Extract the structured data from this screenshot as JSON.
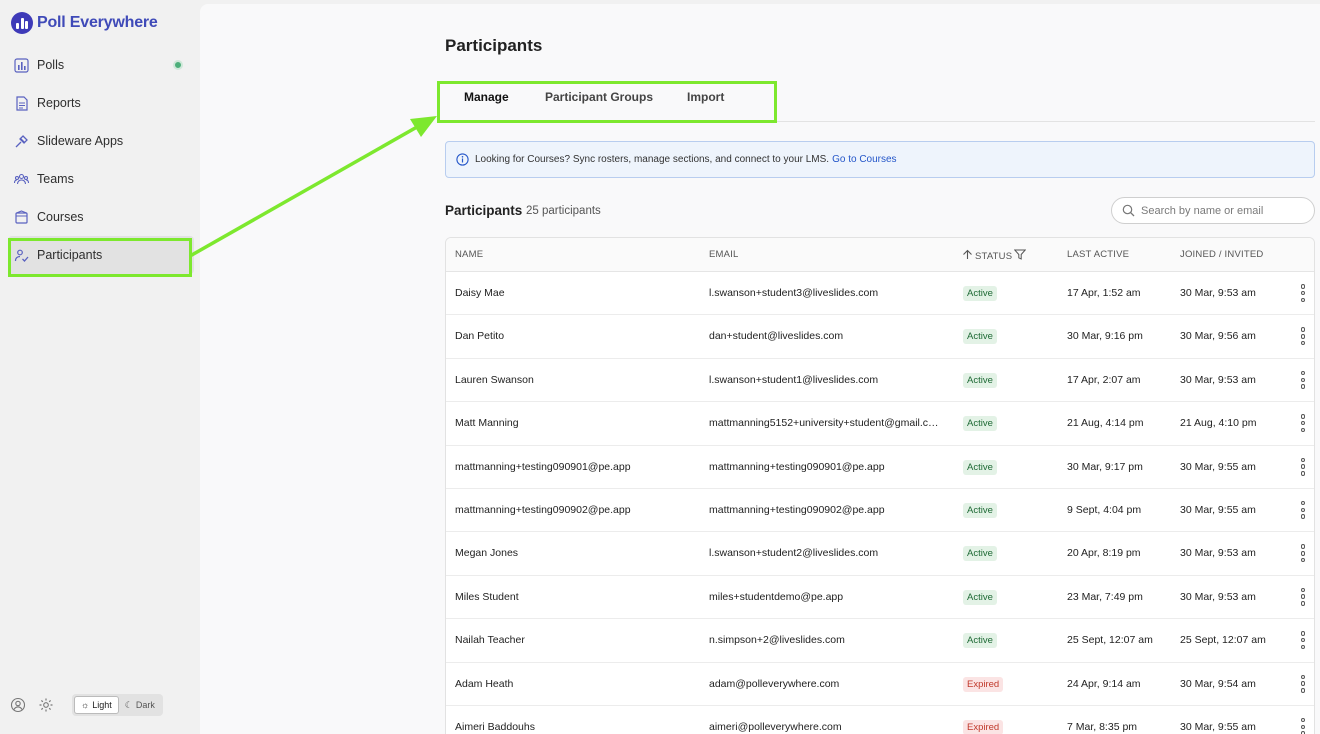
{
  "app": {
    "name": "Poll Everywhere"
  },
  "sidebar": {
    "items": [
      {
        "label": "Polls",
        "icon": "polls-icon"
      },
      {
        "label": "Reports",
        "icon": "reports-icon"
      },
      {
        "label": "Slideware Apps",
        "icon": "slideware-icon"
      },
      {
        "label": "Teams",
        "icon": "teams-icon"
      },
      {
        "label": "Courses",
        "icon": "courses-icon"
      },
      {
        "label": "Participants",
        "icon": "participants-icon"
      }
    ],
    "theme": {
      "light": "Light",
      "dark": "Dark"
    }
  },
  "page": {
    "title": "Participants",
    "tabs": [
      "Manage",
      "Participant Groups",
      "Import"
    ],
    "banner": {
      "text": "Looking for Courses? Sync rosters, manage sections, and connect to your LMS.",
      "link": "Go to Courses"
    },
    "section_title": "Participants",
    "section_count": "25 participants",
    "search_placeholder": "Search by name or email"
  },
  "table": {
    "headers": {
      "name": "NAME",
      "email": "EMAIL",
      "status": "STATUS",
      "last_active": "LAST ACTIVE",
      "joined": "JOINED / INVITED"
    },
    "rows": [
      {
        "name": "Daisy Mae",
        "email": "l.swanson+student3@liveslides.com",
        "status": "Active",
        "last": "17 Apr, 1:52 am",
        "joined": "30 Mar, 9:53 am"
      },
      {
        "name": "Dan Petito",
        "email": "dan+student@liveslides.com",
        "status": "Active",
        "last": "30 Mar, 9:16 pm",
        "joined": "30 Mar, 9:56 am"
      },
      {
        "name": "Lauren Swanson",
        "email": "l.swanson+student1@liveslides.com",
        "status": "Active",
        "last": "17 Apr, 2:07 am",
        "joined": "30 Mar, 9:53 am"
      },
      {
        "name": "Matt Manning",
        "email": "mattmanning5152+university+student@gmail.c…",
        "status": "Active",
        "last": "21 Aug, 4:14 pm",
        "joined": "21 Aug, 4:10 pm"
      },
      {
        "name": "mattmanning+testing090901@pe.app",
        "email": "mattmanning+testing090901@pe.app",
        "status": "Active",
        "last": "30 Mar, 9:17 pm",
        "joined": "30 Mar, 9:55 am"
      },
      {
        "name": "mattmanning+testing090902@pe.app",
        "email": "mattmanning+testing090902@pe.app",
        "status": "Active",
        "last": "9 Sept, 4:04 pm",
        "joined": "30 Mar, 9:55 am"
      },
      {
        "name": "Megan Jones",
        "email": "l.swanson+student2@liveslides.com",
        "status": "Active",
        "last": "20 Apr, 8:19 pm",
        "joined": "30 Mar, 9:53 am"
      },
      {
        "name": "Miles Student",
        "email": "miles+studentdemo@pe.app",
        "status": "Active",
        "last": "23 Mar, 7:49 pm",
        "joined": "30 Mar, 9:53 am"
      },
      {
        "name": "Nailah Teacher",
        "email": "n.simpson+2@liveslides.com",
        "status": "Active",
        "last": "25 Sept, 12:07 am",
        "joined": "25 Sept, 12:07 am"
      },
      {
        "name": "Adam Heath",
        "email": "adam@polleverywhere.com",
        "status": "Expired",
        "last": "24 Apr, 9:14 am",
        "joined": "30 Mar, 9:54 am"
      },
      {
        "name": "Aimeri Baddouhs",
        "email": "aimeri@polleverywhere.com",
        "status": "Expired",
        "last": "7 Mar, 8:35 pm",
        "joined": "30 Mar, 9:55 am"
      }
    ]
  },
  "colors": {
    "brand": "#3e3ab8",
    "highlight": "#7de82e",
    "active_badge": "#1f6a36",
    "expired_badge": "#c0392b",
    "link": "#2456c9"
  }
}
